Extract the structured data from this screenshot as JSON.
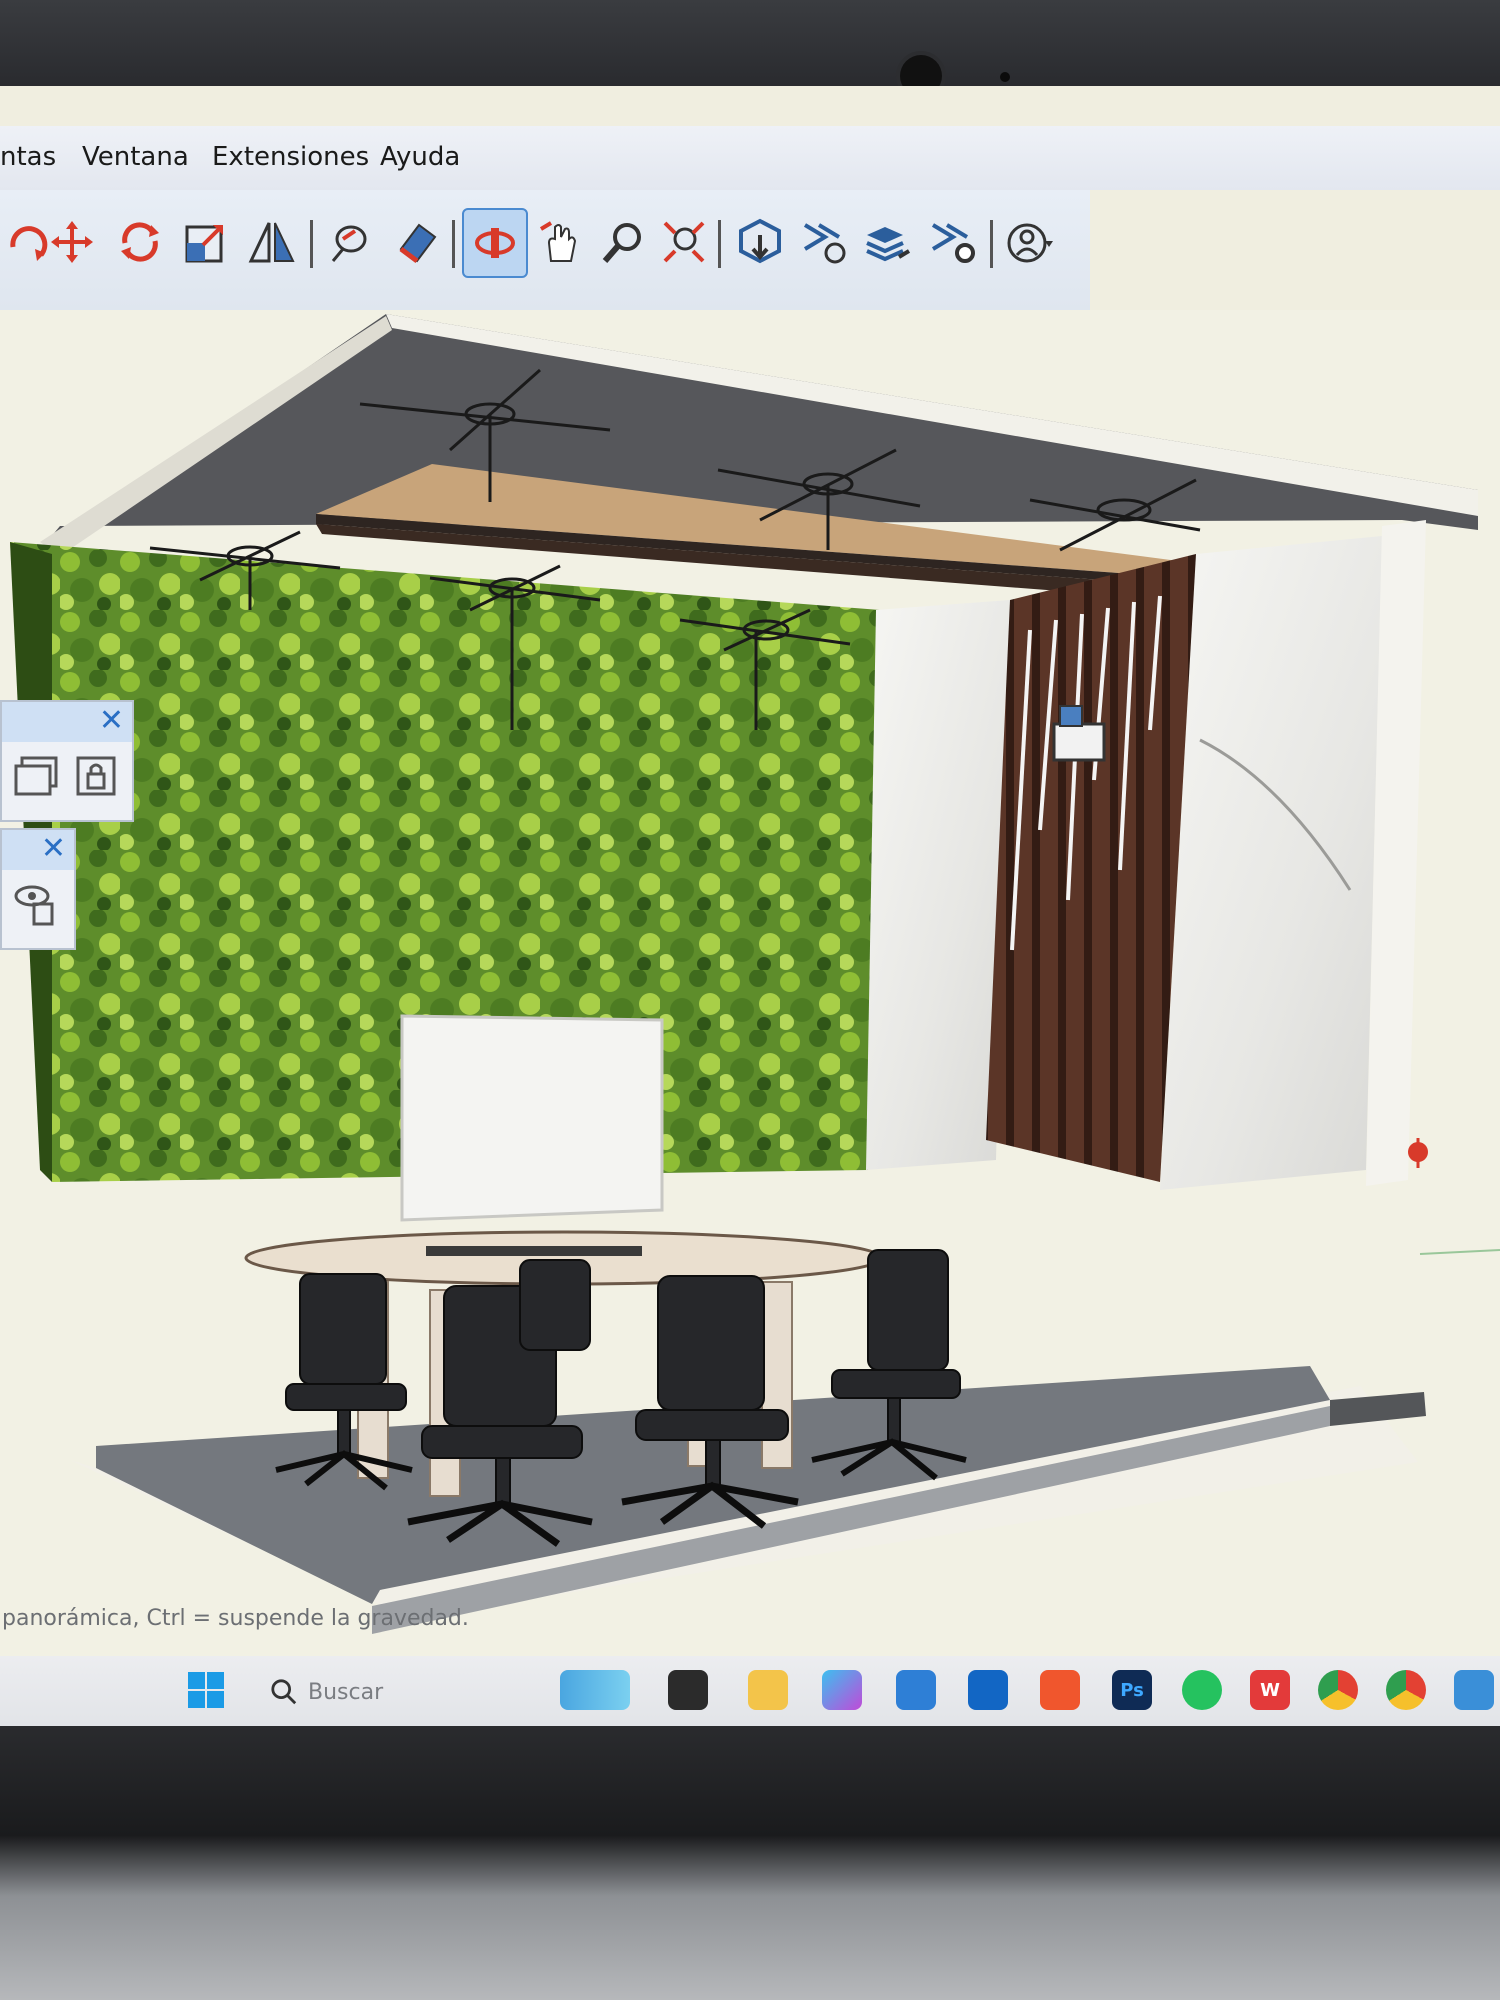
{
  "menu": {
    "items": [
      {
        "label": "ntas"
      },
      {
        "label": "Ventana"
      },
      {
        "label": "Extensiones"
      },
      {
        "label": "Ayuda"
      }
    ]
  },
  "toolbar": {
    "tools": [
      "rotate-icon",
      "move-icon",
      "rotate-arrows-icon",
      "scale-icon",
      "flip-icon",
      "paint-bucket-icon",
      "eraser-icon",
      "orbit-icon",
      "pan-icon",
      "zoom-icon",
      "zoom-extents-icon",
      "component-download-icon",
      "component-share-icon",
      "layers-upload-icon",
      "layers-settings-icon",
      "account-icon"
    ],
    "active_tool": "orbit-icon"
  },
  "status": {
    "hint": "panorámica, Ctrl = suspende la gravedad."
  },
  "taskbar": {
    "search_placeholder": "Buscar"
  },
  "colors": {
    "accent": "#4a8ad0",
    "wall_green": "#5f8f2a",
    "wood": "#5a3526",
    "floor": "#70747a"
  }
}
